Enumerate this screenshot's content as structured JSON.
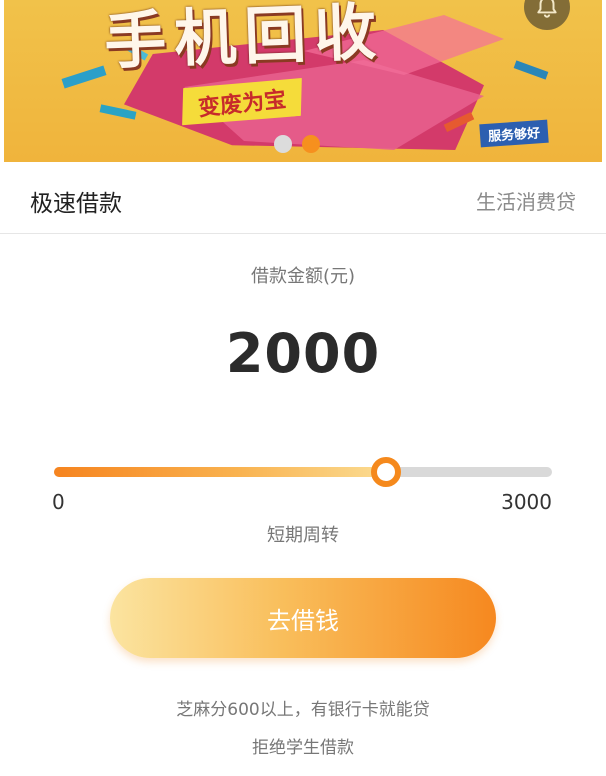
{
  "banner": {
    "title": "手机回收",
    "tag": "变废为宝",
    "badge": "服务够好",
    "slides": 2,
    "active_slide": 2
  },
  "notification": {
    "icon": "bell-icon"
  },
  "header": {
    "title": "极速借款",
    "subtitle": "生活消费贷"
  },
  "loan": {
    "amount_label": "借款金额(元)",
    "amount": "2000",
    "slider_min": "0",
    "slider_max": "3000",
    "slider_value": 2000,
    "period_label": "短期周转"
  },
  "actions": {
    "borrow_label": "去借钱"
  },
  "notes": {
    "line1": "芝麻分600以上，有银行卡就能贷",
    "line2": "拒绝学生借款"
  },
  "colors": {
    "accent": "#f6881f",
    "banner_bg": "#f0b43c",
    "banner_pink": "#d33a6a"
  }
}
